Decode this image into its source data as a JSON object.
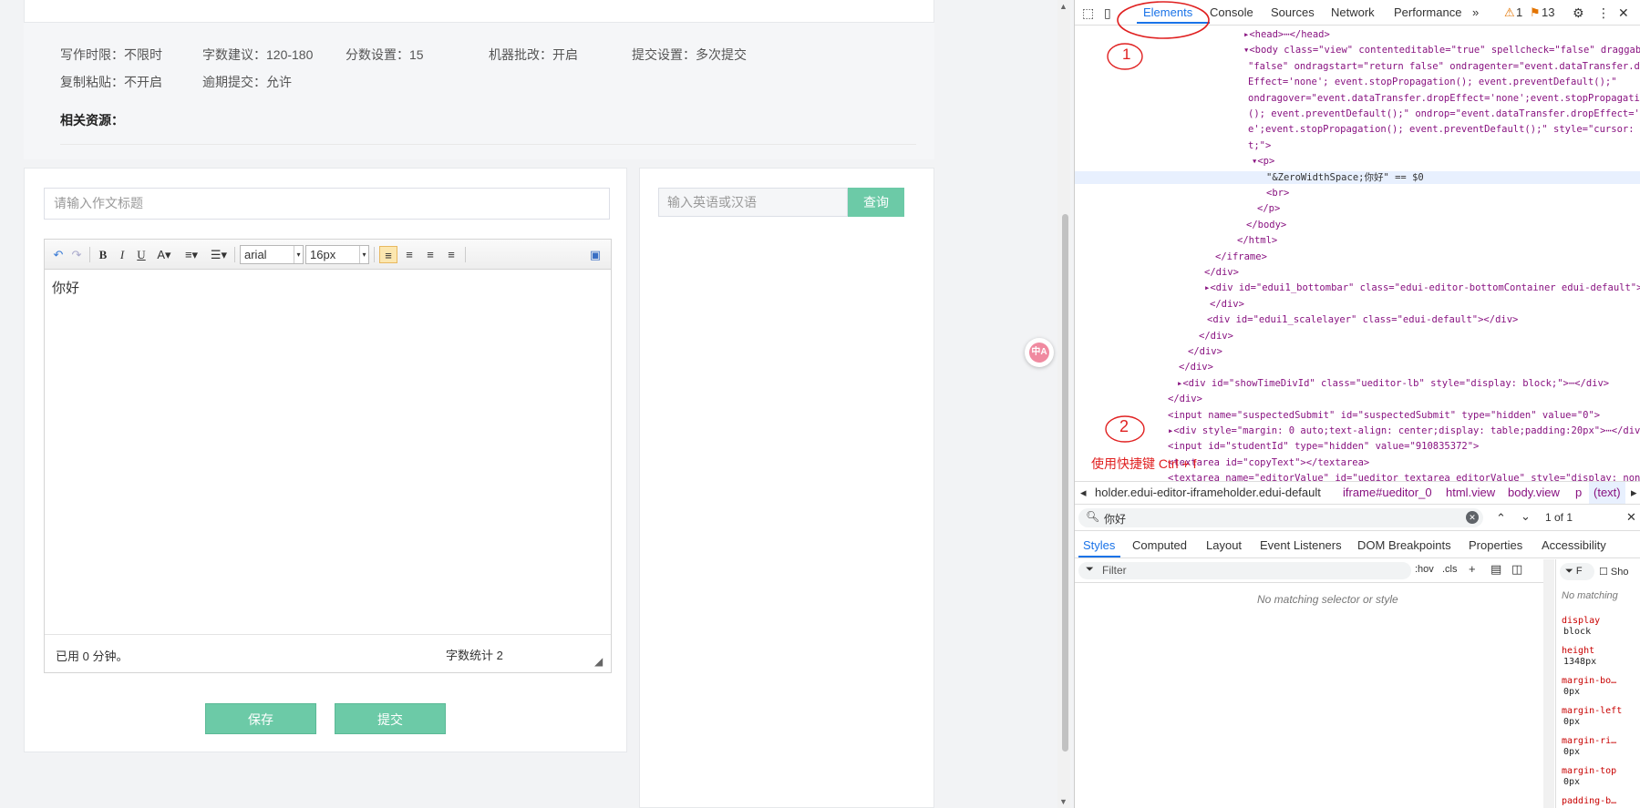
{
  "info": {
    "row1": [
      "写作时限：不限时",
      "字数建议：120-180",
      "分数设置：15",
      "机器批改：开启",
      "提交设置：多次提交"
    ],
    "row2": [
      "复制粘贴：不开启",
      "逾期提交：允许"
    ],
    "resources_label": "相关资源："
  },
  "editor": {
    "title_placeholder": "请输入作文标题",
    "font_family": "arial",
    "font_size": "16px",
    "content": "你好",
    "time_used": "已用 0 分钟。",
    "word_count": "字数统计 2",
    "save_label": "保存",
    "submit_label": "提交"
  },
  "dict": {
    "placeholder": "输入英语或汉语",
    "button": "查询"
  },
  "devtools": {
    "tabs": [
      "Elements",
      "Console",
      "Sources",
      "Network",
      "Performance"
    ],
    "more": "»",
    "warnings": "1",
    "issues": "13",
    "tree_lines": [
      "▸<head>⋯</head>",
      "▾<body class=\"view\" contenteditable=\"true\" spellcheck=\"false\" draggable=",
      "\"false\" ondragstart=\"return false\" ondragenter=\"event.dataTransfer.drop",
      "Effect='none'; event.stopPropagation(); event.preventDefault();\"",
      "ondragover=\"event.dataTransfer.dropEffect='none';event.stopPropagation",
      "(); event.preventDefault();\" ondrop=\"event.dataTransfer.dropEffect='non",
      "e';event.stopPropagation(); event.preventDefault();\" style=\"cursor: tex",
      "t;\">",
      "▾<p>",
      "\"&ZeroWidthSpace;你好\" == $0",
      "<br>",
      "</p>",
      "</body>",
      "</html>",
      "</iframe>",
      "</div>",
      "▸<div id=\"edui1_bottombar\" class=\"edui-editor-bottomContainer edui-default\">⋯",
      "</div>",
      "<div id=\"edui1_scalelayer\" class=\"edui-default\"></div>",
      "</div>",
      "</div>",
      "</div>",
      "▸<div id=\"showTimeDivId\" class=\"ueditor-lb\" style=\"display: block;\">⋯</div>",
      "</div>",
      "<input name=\"suspectedSubmit\" id=\"suspectedSubmit\" type=\"hidden\" value=\"0\">",
      "▸<div style=\"margin: 0 auto;text-align: center;display: table;padding:20px\">⋯</div>",
      "<input id=\"studentId\" type=\"hidden\" value=\"910835372\">",
      "<textarea id=\"copyText\"></textarea>",
      "<textarea name=\"editorValue\" id=\"ueditor_textarea_editorValue\" style=\"display: none;\">"
    ],
    "crumbs": [
      "holder.edui-editor-iframeholder.edui-default",
      "iframe#ueditor_0",
      "html.view",
      "body.view",
      "p",
      "(text)"
    ],
    "find_query": "你好",
    "find_result": "1 of 1",
    "subtabs": [
      "Styles",
      "Computed",
      "Layout",
      "Event Listeners",
      "DOM Breakpoints",
      "Properties",
      "Accessibility"
    ],
    "filter_placeholder": "Filter",
    "hov": ":hov",
    "cls": ".cls",
    "no_matching": "No matching selector or style",
    "right_filter": "F",
    "right_show": "Sho",
    "right_no_matching": "No matching",
    "computed": [
      {
        "prop": "display",
        "val": "block"
      },
      {
        "prop": "height",
        "val": "1348px"
      },
      {
        "prop": "margin-bo…",
        "val": "0px"
      },
      {
        "prop": "margin-left",
        "val": "0px"
      },
      {
        "prop": "margin-ri…",
        "val": "0px"
      },
      {
        "prop": "margin-top",
        "val": "0px"
      },
      {
        "prop": "padding-b…",
        "val": ""
      }
    ]
  },
  "annotations": {
    "one": "1",
    "two": "2",
    "hint": "使用快捷键 Ctrl + f"
  }
}
